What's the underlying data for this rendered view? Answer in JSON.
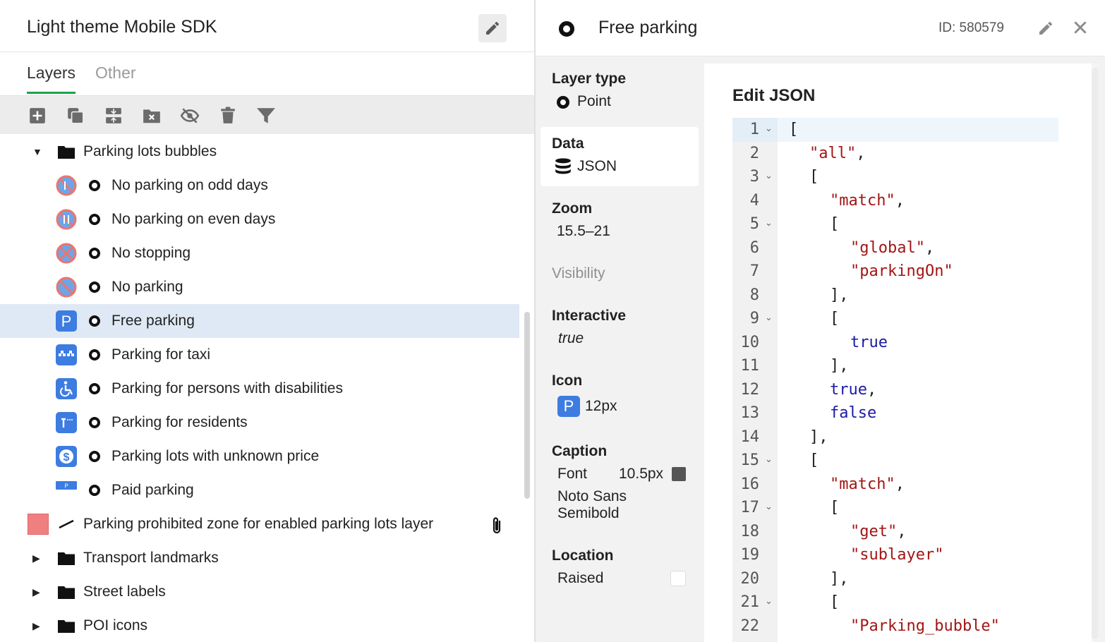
{
  "left": {
    "title": "Light theme Mobile SDK",
    "tabs": [
      {
        "label": "Layers"
      },
      {
        "label": "Other"
      }
    ],
    "toolbar": [
      "add-icon",
      "duplicate-icon",
      "merge-icon",
      "remove-folder-icon",
      "hide-icon",
      "delete-icon",
      "filter-icon"
    ],
    "tree": {
      "group": "Parking lots bubbles",
      "items": [
        {
          "label": "No parking on odd days",
          "icon": "no-parking-odd-icon"
        },
        {
          "label": "No parking on even days",
          "icon": "no-parking-even-icon"
        },
        {
          "label": "No stopping",
          "icon": "no-stopping-icon"
        },
        {
          "label": "No parking",
          "icon": "no-parking-icon"
        },
        {
          "label": "Free parking",
          "icon": "free-parking-icon"
        },
        {
          "label": "Parking for taxi",
          "icon": "taxi-parking-icon"
        },
        {
          "label": "Parking for persons with disabilities",
          "icon": "disabled-parking-icon"
        },
        {
          "label": "Parking for residents",
          "icon": "resident-parking-icon"
        },
        {
          "label": "Parking lots with unknown price",
          "icon": "price-parking-icon"
        },
        {
          "label": "Paid parking",
          "icon": "paid-parking-icon"
        }
      ],
      "zone_layer": "Parking prohibited zone for enabled parking lots layer",
      "zone_color": "#f08080",
      "folders": [
        "Transport landmarks",
        "Street labels",
        "POI icons"
      ]
    }
  },
  "right": {
    "title": "Free parking",
    "id_label": "ID: 580579",
    "layer_type": {
      "label": "Layer type",
      "value": "Point"
    },
    "data": {
      "label": "Data",
      "value": "JSON"
    },
    "zoom": {
      "label": "Zoom",
      "value": "15.5–21"
    },
    "visibility": {
      "label": "Visibility"
    },
    "interactive": {
      "label": "Interactive",
      "value": "true"
    },
    "icon": {
      "label": "Icon",
      "badge": "P",
      "value": "12px"
    },
    "caption": {
      "label": "Caption",
      "font_label": "Font",
      "size": "10.5px",
      "font_name_1": "Noto Sans",
      "font_name_2": "Semibold"
    },
    "location": {
      "label": "Location",
      "value": "Raised"
    },
    "editor": {
      "title": "Edit JSON",
      "lines": [
        {
          "n": "1",
          "fold": true,
          "indent": 0,
          "parts": [
            [
              "punc",
              "["
            ]
          ]
        },
        {
          "n": "2",
          "fold": false,
          "indent": 1,
          "parts": [
            [
              "str",
              "\"all\""
            ],
            [
              "punc",
              ","
            ]
          ]
        },
        {
          "n": "3",
          "fold": true,
          "indent": 1,
          "parts": [
            [
              "punc",
              "["
            ]
          ]
        },
        {
          "n": "4",
          "fold": false,
          "indent": 2,
          "parts": [
            [
              "str",
              "\"match\""
            ],
            [
              "punc",
              ","
            ]
          ]
        },
        {
          "n": "5",
          "fold": true,
          "indent": 2,
          "parts": [
            [
              "punc",
              "["
            ]
          ]
        },
        {
          "n": "6",
          "fold": false,
          "indent": 3,
          "parts": [
            [
              "str",
              "\"global\""
            ],
            [
              "punc",
              ","
            ]
          ]
        },
        {
          "n": "7",
          "fold": false,
          "indent": 3,
          "parts": [
            [
              "str",
              "\"parkingOn\""
            ]
          ]
        },
        {
          "n": "8",
          "fold": false,
          "indent": 2,
          "parts": [
            [
              "punc",
              "],"
            ]
          ]
        },
        {
          "n": "9",
          "fold": true,
          "indent": 2,
          "parts": [
            [
              "punc",
              "["
            ]
          ]
        },
        {
          "n": "10",
          "fold": false,
          "indent": 3,
          "parts": [
            [
              "kw",
              "true"
            ]
          ]
        },
        {
          "n": "11",
          "fold": false,
          "indent": 2,
          "parts": [
            [
              "punc",
              "],"
            ]
          ]
        },
        {
          "n": "12",
          "fold": false,
          "indent": 2,
          "parts": [
            [
              "kw",
              "true"
            ],
            [
              "punc",
              ","
            ]
          ]
        },
        {
          "n": "13",
          "fold": false,
          "indent": 2,
          "parts": [
            [
              "kw",
              "false"
            ]
          ]
        },
        {
          "n": "14",
          "fold": false,
          "indent": 1,
          "parts": [
            [
              "punc",
              "],"
            ]
          ]
        },
        {
          "n": "15",
          "fold": true,
          "indent": 1,
          "parts": [
            [
              "punc",
              "["
            ]
          ]
        },
        {
          "n": "16",
          "fold": false,
          "indent": 2,
          "parts": [
            [
              "str",
              "\"match\""
            ],
            [
              "punc",
              ","
            ]
          ]
        },
        {
          "n": "17",
          "fold": true,
          "indent": 2,
          "parts": [
            [
              "punc",
              "["
            ]
          ]
        },
        {
          "n": "18",
          "fold": false,
          "indent": 3,
          "parts": [
            [
              "str",
              "\"get\""
            ],
            [
              "punc",
              ","
            ]
          ]
        },
        {
          "n": "19",
          "fold": false,
          "indent": 3,
          "parts": [
            [
              "str",
              "\"sublayer\""
            ]
          ]
        },
        {
          "n": "20",
          "fold": false,
          "indent": 2,
          "parts": [
            [
              "punc",
              "],"
            ]
          ]
        },
        {
          "n": "21",
          "fold": true,
          "indent": 2,
          "parts": [
            [
              "punc",
              "["
            ]
          ]
        },
        {
          "n": "22",
          "fold": false,
          "indent": 3,
          "parts": [
            [
              "str",
              "\"Parking_bubble\""
            ]
          ]
        }
      ]
    }
  }
}
